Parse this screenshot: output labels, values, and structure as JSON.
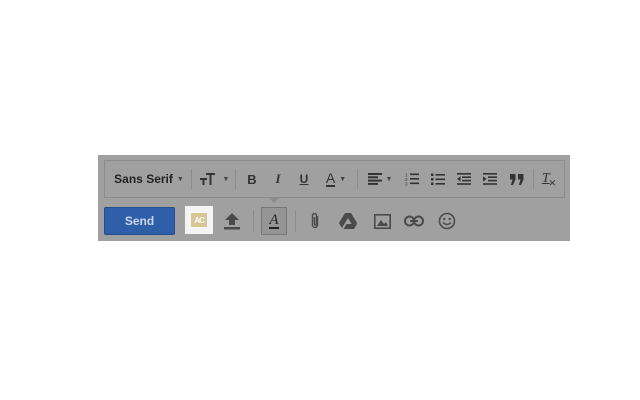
{
  "formatting_toolbar": {
    "font_family": "Sans Serif",
    "bold": "B",
    "italic": "I",
    "underline": "U",
    "text_color": "A",
    "clear_formatting": "T"
  },
  "bottom_bar": {
    "send_label": "Send",
    "addon_logo": "AC",
    "formatting_toggle": "A"
  },
  "colors": {
    "send_button": "#2f5fa8",
    "overlay": "#a0a0a0"
  }
}
